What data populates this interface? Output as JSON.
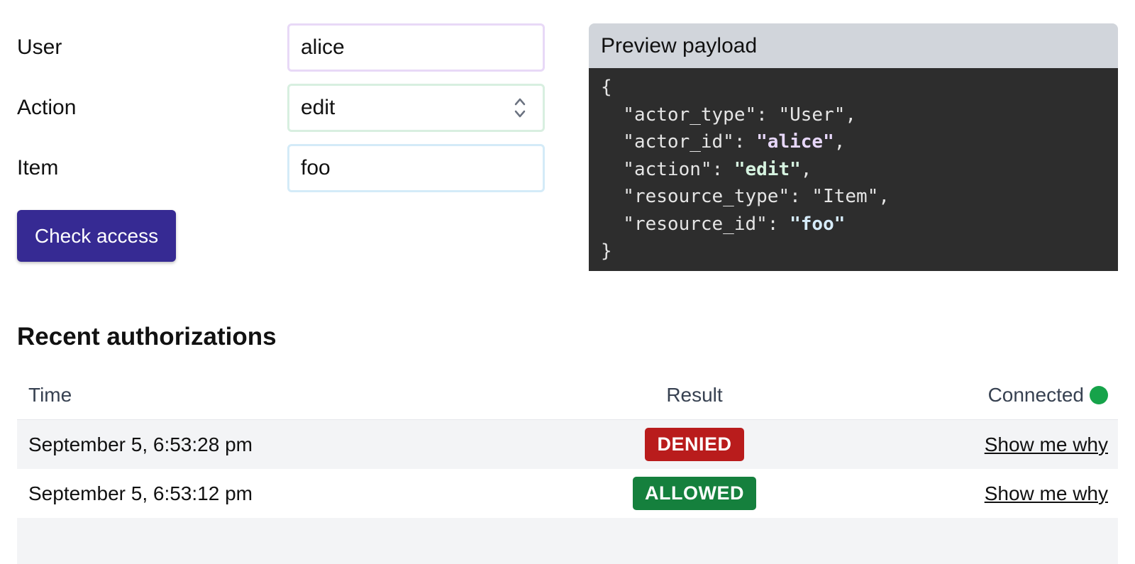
{
  "form": {
    "user_label": "User",
    "user_value": "alice",
    "action_label": "Action",
    "action_value": "edit",
    "item_label": "Item",
    "item_value": "foo",
    "check_button_label": "Check access"
  },
  "preview": {
    "title": "Preview payload",
    "open_brace": "{",
    "close_brace": "}",
    "lines": {
      "actor_type_key": "  \"actor_type\": ",
      "actor_type_val": "\"User\"",
      "actor_id_key": "  \"actor_id\": ",
      "actor_id_val": "\"alice\"",
      "action_key": "  \"action\": ",
      "action_val": "\"edit\"",
      "resource_type_key": "  \"resource_type\": ",
      "resource_type_val": "\"Item\"",
      "resource_id_key": "  \"resource_id\": ",
      "resource_id_val": "\"foo\"",
      "comma": ","
    }
  },
  "recent": {
    "title": "Recent authorizations",
    "columns": {
      "time": "Time",
      "result": "Result",
      "status": "Connected"
    },
    "status_color": "#16a34a",
    "rows": [
      {
        "time": "September 5, 6:53:28 pm",
        "result": "DENIED",
        "result_color": "#b91c1c",
        "link": "Show me why"
      },
      {
        "time": "September 5, 6:53:12 pm",
        "result": "ALLOWED",
        "result_color": "#15803d",
        "link": "Show me why"
      }
    ]
  },
  "icons": {
    "select_arrows": "chevron-up-down-icon",
    "status_dot": "status-dot-icon"
  }
}
